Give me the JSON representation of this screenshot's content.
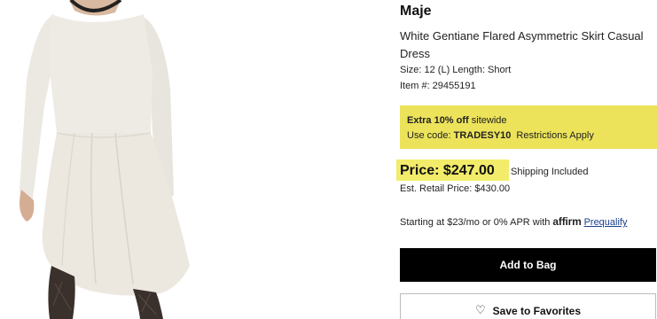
{
  "product": {
    "brand": "Maje",
    "title": "White Gentiane Flared Asymmetric Skirt Casual Dress",
    "size_line": "Size: 12 (L) Length: Short",
    "item_line": "Item #: 29455191"
  },
  "promo": {
    "discount_bold": "Extra 10% off",
    "discount_rest": " sitewide",
    "code_prefix": "Use code: ",
    "code": "TRADESY10",
    "restrictions_link": "Restrictions Apply",
    "highlight_color": "#ece35a"
  },
  "pricing": {
    "price": "Price: $247.00",
    "shipping": "Shipping Included",
    "retail": "Est. Retail Price: $430.00"
  },
  "financing": {
    "text": "Starting at $23/mo or 0% APR with ",
    "brand": "affirm",
    "link": "Prequalify"
  },
  "actions": {
    "add_to_bag": "Add to Bag",
    "save_favorites": "Save to Favorites",
    "heart_icon": "heart-icon"
  }
}
